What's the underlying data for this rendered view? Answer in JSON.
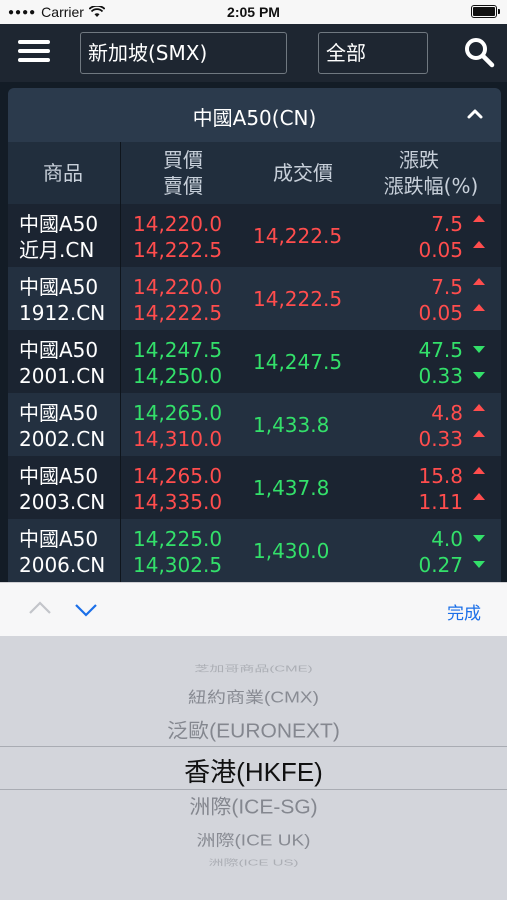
{
  "status": {
    "carrier": "Carrier",
    "time": "2:05 PM"
  },
  "topbar": {
    "market": "新加坡(SMX)",
    "type": "全部"
  },
  "section": {
    "title": "中國A50(CN)"
  },
  "columns": {
    "product": "商品",
    "bid": "買價",
    "ask": "賣價",
    "last": "成交價",
    "change": "漲跌",
    "change_pct": "漲跌幅(%)"
  },
  "rows": [
    {
      "name1": "中國A50",
      "name2": "近月.CN",
      "bid": "14,220.0",
      "ask": "14,222.5",
      "last": "14,222.5",
      "chg": "7.5",
      "pct": "0.05",
      "bid_color": "red",
      "ask_color": "red",
      "last_color": "red",
      "dir": "up"
    },
    {
      "name1": "中國A50",
      "name2": "1912.CN",
      "bid": "14,220.0",
      "ask": "14,222.5",
      "last": "14,222.5",
      "chg": "7.5",
      "pct": "0.05",
      "bid_color": "red",
      "ask_color": "red",
      "last_color": "red",
      "dir": "up"
    },
    {
      "name1": "中國A50",
      "name2": "2001.CN",
      "bid": "14,247.5",
      "ask": "14,250.0",
      "last": "14,247.5",
      "chg": "47.5",
      "pct": "0.33",
      "bid_color": "green",
      "ask_color": "green",
      "last_color": "green",
      "dir": "down"
    },
    {
      "name1": "中國A50",
      "name2": "2002.CN",
      "bid": "14,265.0",
      "ask": "14,310.0",
      "last": "1,433.8",
      "chg": "4.8",
      "pct": "0.33",
      "bid_color": "green",
      "ask_color": "red",
      "last_color": "green",
      "dir": "up"
    },
    {
      "name1": "中國A50",
      "name2": "2003.CN",
      "bid": "14,265.0",
      "ask": "14,335.0",
      "last": "1,437.8",
      "chg": "15.8",
      "pct": "1.11",
      "bid_color": "red",
      "ask_color": "red",
      "last_color": "green",
      "dir": "up"
    },
    {
      "name1": "中國A50",
      "name2": "2006.CN",
      "bid": "14,225.0",
      "ask": "14,302.5",
      "last": "1,430.0",
      "chg": "4.0",
      "pct": "0.27",
      "bid_color": "green",
      "ask_color": "green",
      "last_color": "green",
      "dir": "down"
    }
  ],
  "picker": {
    "done": "完成",
    "options": [
      "芝加哥商品(CME)",
      "紐約商業(CMX)",
      "泛歐(EURONEXT)",
      "香港(HKFE)",
      "洲際(ICE-SG)",
      "洲際(ICE UK)",
      "洲際(ICE US)"
    ],
    "selected": "香港(HKFE)"
  },
  "colors": {
    "red": "#ff4d4d",
    "green": "#33e06a",
    "accent": "#1b6fe8"
  }
}
